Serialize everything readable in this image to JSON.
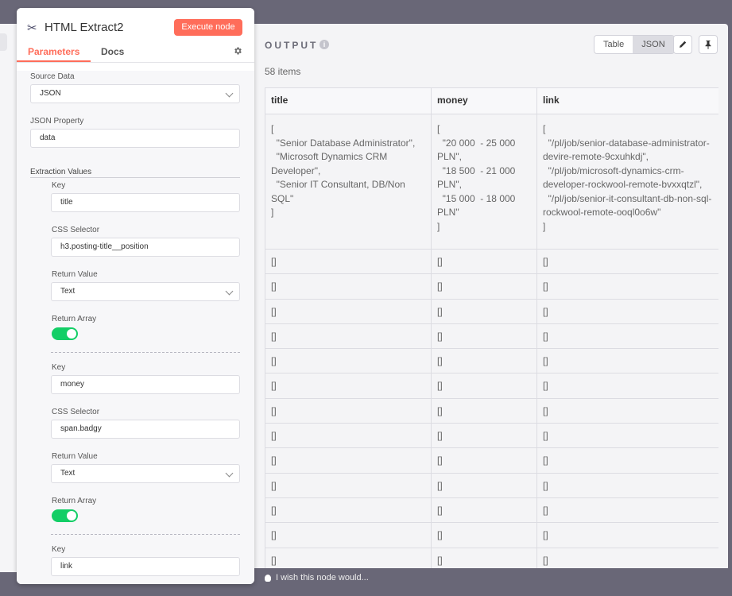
{
  "node": {
    "title": "HTML Extract2",
    "execute_label": "Execute node",
    "tabs": {
      "parameters": "Parameters",
      "docs": "Docs"
    }
  },
  "params": {
    "source_data": {
      "label": "Source Data",
      "value": "JSON"
    },
    "json_property": {
      "label": "JSON Property",
      "value": "data"
    },
    "extraction_values_label": "Extraction Values",
    "extractions": [
      {
        "key_label": "Key",
        "key": "title",
        "css_label": "CSS Selector",
        "css": "h3.posting-title__position",
        "return_value_label": "Return Value",
        "return_value": "Text",
        "return_array_label": "Return Array",
        "return_array": true
      },
      {
        "key_label": "Key",
        "key": "money",
        "css_label": "CSS Selector",
        "css": "span.badgy",
        "return_value_label": "Return Value",
        "return_value": "Text",
        "return_array_label": "Return Array",
        "return_array": true
      },
      {
        "key_label": "Key",
        "key": "link"
      }
    ]
  },
  "output": {
    "title": "OUTPUT",
    "item_count": "58 items",
    "view_table": "Table",
    "view_json": "JSON",
    "columns": [
      "title",
      "money",
      "link"
    ],
    "first_row": {
      "title": [
        "[",
        "  \"Senior Database Administrator\",",
        "  \"Microsoft Dynamics CRM Developer\",",
        "  \"Senior IT Consultant, DB/Non SQL\"",
        "]"
      ],
      "money": [
        "[",
        "  \"20 000  - 25 000 PLN\",",
        "  \"18 500  - 21 000 PLN\",",
        "  \"15 000  - 18 000 PLN\"",
        "]"
      ],
      "link": [
        "[",
        "  \"/pl/job/senior-database-administrator-devire-remote-9cxuhkdj\",",
        "  \"/pl/job/microsoft-dynamics-crm-developer-rockwool-remote-bvxxqtzl\",",
        "  \"/pl/job/senior-it-consultant-db-non-sql-rockwool-remote-ooql0o6w\"",
        "]"
      ]
    },
    "empty_cell": "[]"
  },
  "feedback": "I wish this node would..."
}
